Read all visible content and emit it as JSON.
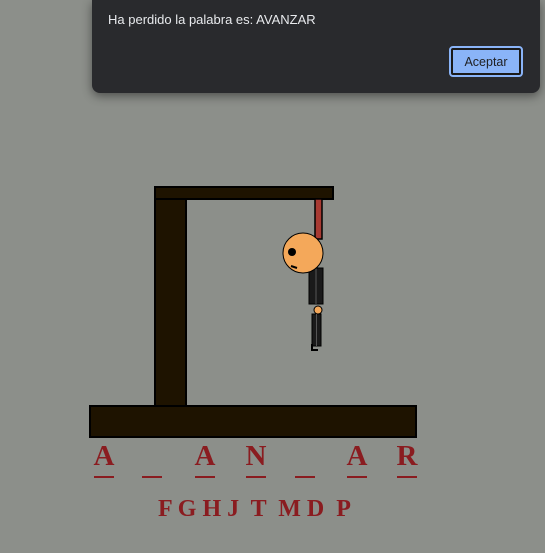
{
  "dialog": {
    "message": "Ha perdido la palabra es: AVANZAR",
    "ok_label": "Aceptar"
  },
  "game": {
    "word_slots": [
      "A",
      "_",
      "A",
      "N",
      "_",
      "A",
      "R"
    ],
    "wrong_letters": "F G H J  T  M D  P",
    "colors": {
      "background": "#8c8f8a",
      "wood": "#1e1300",
      "rope": "#a83a32",
      "head": "#f4a85a",
      "letters": "#8a1c20"
    }
  }
}
